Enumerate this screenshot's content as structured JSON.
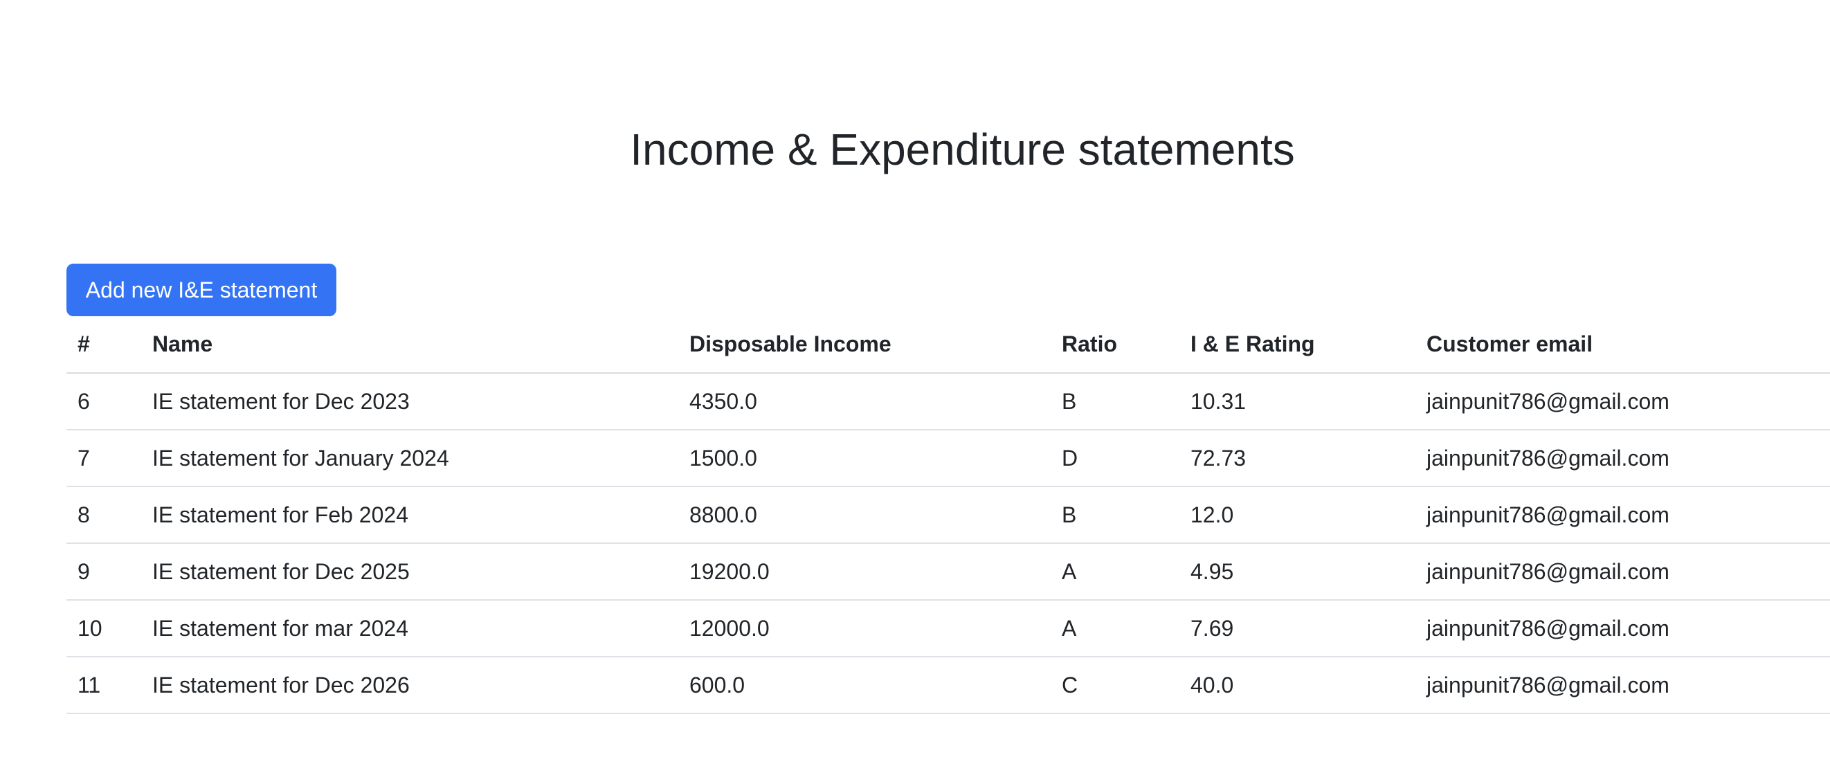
{
  "page": {
    "title": "Income & Expenditure statements",
    "add_button_label": "Add new I&E statement"
  },
  "table": {
    "headers": {
      "id": "#",
      "name": "Name",
      "disposable_income": "Disposable Income",
      "ratio": "Ratio",
      "rating": "I & E Rating",
      "email": "Customer email"
    },
    "rows": [
      {
        "id": "6",
        "name": "IE statement for Dec 2023",
        "disposable_income": "4350.0",
        "ratio": "B",
        "rating": "10.31",
        "email": "jainpunit786@gmail.com"
      },
      {
        "id": "7",
        "name": "IE statement for January 2024",
        "disposable_income": "1500.0",
        "ratio": "D",
        "rating": "72.73",
        "email": "jainpunit786@gmail.com"
      },
      {
        "id": "8",
        "name": "IE statement for Feb 2024",
        "disposable_income": "8800.0",
        "ratio": "B",
        "rating": "12.0",
        "email": "jainpunit786@gmail.com"
      },
      {
        "id": "9",
        "name": "IE statement for Dec 2025",
        "disposable_income": "19200.0",
        "ratio": "A",
        "rating": "4.95",
        "email": "jainpunit786@gmail.com"
      },
      {
        "id": "10",
        "name": "IE statement for mar 2024",
        "disposable_income": "12000.0",
        "ratio": "A",
        "rating": "7.69",
        "email": "jainpunit786@gmail.com"
      },
      {
        "id": "11",
        "name": "IE statement for Dec 2026",
        "disposable_income": "600.0",
        "ratio": "C",
        "rating": "40.0",
        "email": "jainpunit786@gmail.com"
      }
    ]
  },
  "colors": {
    "primary_button": "#3474f4",
    "text": "#212529",
    "row_border": "#dee2e6"
  }
}
